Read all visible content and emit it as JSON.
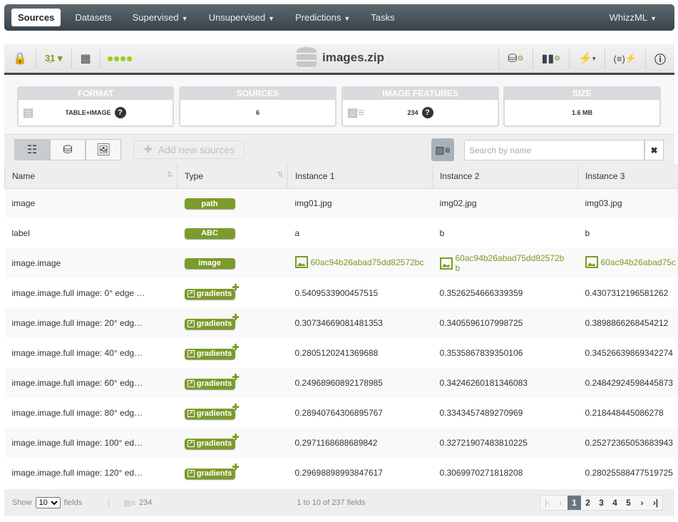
{
  "nav": {
    "items": [
      {
        "label": "Sources",
        "active": true
      },
      {
        "label": "Datasets"
      },
      {
        "label": "Supervised",
        "caret": true
      },
      {
        "label": "Unsupervised",
        "caret": true
      },
      {
        "label": "Predictions",
        "caret": true
      },
      {
        "label": "Tasks"
      }
    ],
    "right": "WhizzML"
  },
  "toolbar": {
    "title": "images.zip",
    "status_dots": 4,
    "accent": "#9acd1c"
  },
  "summary": {
    "format": {
      "label": "FORMAT",
      "value": "TABLE+IMAGE"
    },
    "sources": {
      "label": "SOURCES",
      "value": "6"
    },
    "features": {
      "label": "IMAGE FEATURES",
      "value": "234"
    },
    "size": {
      "label": "SIZE",
      "value": "1.6 MB"
    }
  },
  "actions": {
    "add": "Add new sources",
    "search_placeholder": "Search by name"
  },
  "table": {
    "headers": [
      "Name",
      "Type",
      "Instance 1",
      "Instance 2",
      "Instance 3"
    ],
    "rows": [
      {
        "name": "image",
        "type": "path",
        "v": [
          "img01.jpg",
          "img02.jpg",
          "img03.jpg"
        ]
      },
      {
        "name": "label",
        "type": "ABC",
        "v": [
          "a",
          "b",
          "b"
        ]
      },
      {
        "name": "image.image",
        "type": "image",
        "v": [
          "60ac94b26abad75dd82572bc",
          "60ac94b26abad75dd82572bb",
          "60ac94b26abad75c"
        ],
        "link": true
      },
      {
        "name": "image.image.full image: 0° edge …",
        "type": "gradients",
        "v": [
          "0.5409533900457515",
          "0.3526254666339359",
          "0.4307312196581262"
        ]
      },
      {
        "name": "image.image.full image: 20° edg…",
        "type": "gradients",
        "v": [
          "0.30734669081481353",
          "0.3405596107998725",
          "0.3898866268454212"
        ]
      },
      {
        "name": "image.image.full image: 40° edg…",
        "type": "gradients",
        "v": [
          "0.2805120241369688",
          "0.3535867839350106",
          "0.34526639869342274"
        ]
      },
      {
        "name": "image.image.full image: 60° edg…",
        "type": "gradients",
        "v": [
          "0.24968960892178985",
          "0.34246260181346083",
          "0.24842924598445873"
        ]
      },
      {
        "name": "image.image.full image: 80° edg…",
        "type": "gradients",
        "v": [
          "0.28940764306895767",
          "0.3343457489270969",
          "0.218448445086278"
        ]
      },
      {
        "name": "image.image.full image: 100° ed…",
        "type": "gradients",
        "v": [
          "0.2971168688689842",
          "0.32721907483810225",
          "0.25272365053683943"
        ]
      },
      {
        "name": "image.image.full image: 120° ed…",
        "type": "gradients",
        "v": [
          "0.29698898993847617",
          "0.3069970271818208",
          "0.28025588477519725"
        ]
      }
    ]
  },
  "footer": {
    "show": "Show",
    "page_size": "10",
    "fields": "fields",
    "feature_count": "234",
    "range": "1 to 10 of 237 fields",
    "pages": [
      "1",
      "2",
      "3",
      "4",
      "5"
    ],
    "current_page": "1"
  }
}
